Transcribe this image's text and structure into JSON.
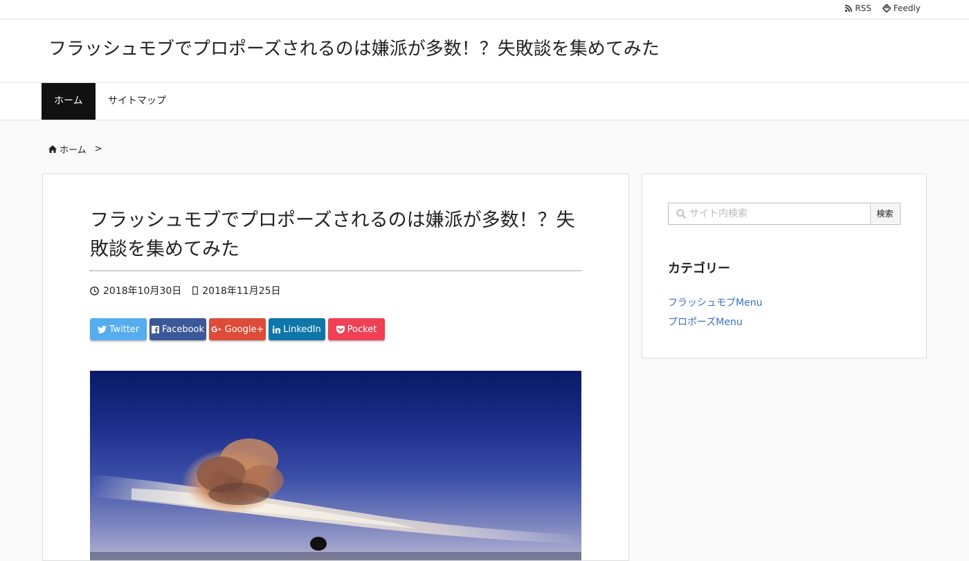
{
  "topbar": {
    "rss_label": "RSS",
    "feedly_label": "Feedly"
  },
  "site": {
    "title": "フラッシュモブでプロポーズされるのは嫌派が多数！？失敗談を集めてみた"
  },
  "nav": {
    "items": [
      {
        "label": "ホーム",
        "active": true
      },
      {
        "label": "サイトマップ",
        "active": false
      }
    ]
  },
  "breadcrumb": {
    "home_label": "ホーム",
    "separator": ">"
  },
  "article": {
    "title": "フラッシュモブでプロポーズされるのは嫌派が多数！？失敗談を集めてみた",
    "published": "2018年10月30日",
    "updated": "2018年11月25日",
    "share": [
      {
        "label": "Twitter",
        "color": "#55acee",
        "icon": "twitter-icon"
      },
      {
        "label": "Facebook",
        "color": "#3b5998",
        "icon": "facebook-icon"
      },
      {
        "label": "Google+",
        "color": "#dd4b39",
        "icon": "google-plus-icon"
      },
      {
        "label": "LinkedIn",
        "color": "#0e76a8",
        "icon": "linkedin-icon"
      },
      {
        "label": "Pocket",
        "color": "#ef4056",
        "icon": "pocket-icon"
      }
    ],
    "hero_image": "sunset sky with pink cloud and silhouette"
  },
  "sidebar": {
    "search_placeholder": "サイト内検索",
    "search_button": "検索",
    "category_title": "カテゴリー",
    "categories": [
      "フラッシュモブMenu",
      "プロポーズMenu"
    ]
  }
}
